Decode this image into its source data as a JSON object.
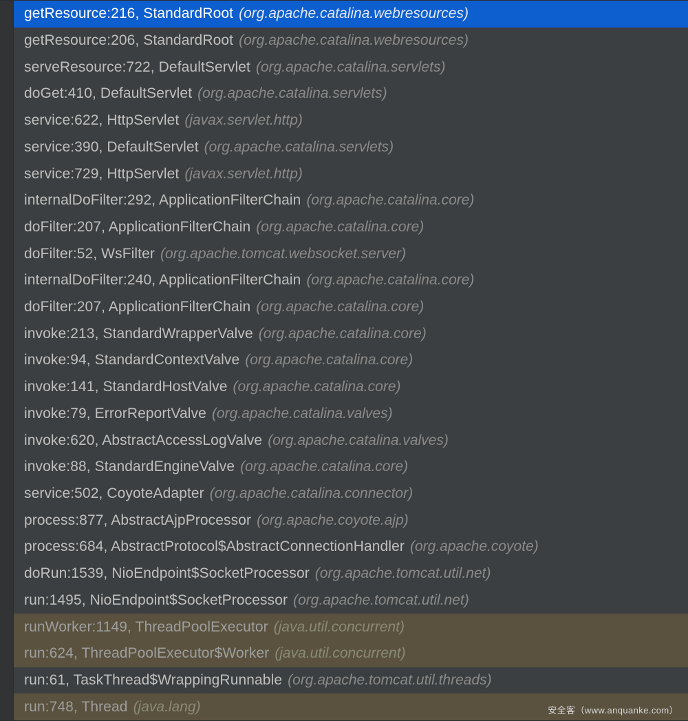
{
  "watermark": "安全客（www.anquanke.com）",
  "frames": [
    {
      "method": "getResource",
      "line": 216,
      "class": "StandardRoot",
      "package": "org.apache.catalina.webresources",
      "selected": true,
      "lib": false
    },
    {
      "method": "getResource",
      "line": 206,
      "class": "StandardRoot",
      "package": "org.apache.catalina.webresources",
      "selected": false,
      "lib": false
    },
    {
      "method": "serveResource",
      "line": 722,
      "class": "DefaultServlet",
      "package": "org.apache.catalina.servlets",
      "selected": false,
      "lib": false
    },
    {
      "method": "doGet",
      "line": 410,
      "class": "DefaultServlet",
      "package": "org.apache.catalina.servlets",
      "selected": false,
      "lib": false
    },
    {
      "method": "service",
      "line": 622,
      "class": "HttpServlet",
      "package": "javax.servlet.http",
      "selected": false,
      "lib": false
    },
    {
      "method": "service",
      "line": 390,
      "class": "DefaultServlet",
      "package": "org.apache.catalina.servlets",
      "selected": false,
      "lib": false
    },
    {
      "method": "service",
      "line": 729,
      "class": "HttpServlet",
      "package": "javax.servlet.http",
      "selected": false,
      "lib": false
    },
    {
      "method": "internalDoFilter",
      "line": 292,
      "class": "ApplicationFilterChain",
      "package": "org.apache.catalina.core",
      "selected": false,
      "lib": false
    },
    {
      "method": "doFilter",
      "line": 207,
      "class": "ApplicationFilterChain",
      "package": "org.apache.catalina.core",
      "selected": false,
      "lib": false
    },
    {
      "method": "doFilter",
      "line": 52,
      "class": "WsFilter",
      "package": "org.apache.tomcat.websocket.server",
      "selected": false,
      "lib": false
    },
    {
      "method": "internalDoFilter",
      "line": 240,
      "class": "ApplicationFilterChain",
      "package": "org.apache.catalina.core",
      "selected": false,
      "lib": false
    },
    {
      "method": "doFilter",
      "line": 207,
      "class": "ApplicationFilterChain",
      "package": "org.apache.catalina.core",
      "selected": false,
      "lib": false
    },
    {
      "method": "invoke",
      "line": 213,
      "class": "StandardWrapperValve",
      "package": "org.apache.catalina.core",
      "selected": false,
      "lib": false
    },
    {
      "method": "invoke",
      "line": 94,
      "class": "StandardContextValve",
      "package": "org.apache.catalina.core",
      "selected": false,
      "lib": false
    },
    {
      "method": "invoke",
      "line": 141,
      "class": "StandardHostValve",
      "package": "org.apache.catalina.core",
      "selected": false,
      "lib": false
    },
    {
      "method": "invoke",
      "line": 79,
      "class": "ErrorReportValve",
      "package": "org.apache.catalina.valves",
      "selected": false,
      "lib": false
    },
    {
      "method": "invoke",
      "line": 620,
      "class": "AbstractAccessLogValve",
      "package": "org.apache.catalina.valves",
      "selected": false,
      "lib": false
    },
    {
      "method": "invoke",
      "line": 88,
      "class": "StandardEngineValve",
      "package": "org.apache.catalina.core",
      "selected": false,
      "lib": false
    },
    {
      "method": "service",
      "line": 502,
      "class": "CoyoteAdapter",
      "package": "org.apache.catalina.connector",
      "selected": false,
      "lib": false
    },
    {
      "method": "process",
      "line": 877,
      "class": "AbstractAjpProcessor",
      "package": "org.apache.coyote.ajp",
      "selected": false,
      "lib": false
    },
    {
      "method": "process",
      "line": 684,
      "class": "AbstractProtocol$AbstractConnectionHandler",
      "package": "org.apache.coyote",
      "selected": false,
      "lib": false
    },
    {
      "method": "doRun",
      "line": 1539,
      "class": "NioEndpoint$SocketProcessor",
      "package": "org.apache.tomcat.util.net",
      "selected": false,
      "lib": false
    },
    {
      "method": "run",
      "line": 1495,
      "class": "NioEndpoint$SocketProcessor",
      "package": "org.apache.tomcat.util.net",
      "selected": false,
      "lib": false
    },
    {
      "method": "runWorker",
      "line": 1149,
      "class": "ThreadPoolExecutor",
      "package": "java.util.concurrent",
      "selected": false,
      "lib": true
    },
    {
      "method": "run",
      "line": 624,
      "class": "ThreadPoolExecutor$Worker",
      "package": "java.util.concurrent",
      "selected": false,
      "lib": true
    },
    {
      "method": "run",
      "line": 61,
      "class": "TaskThread$WrappingRunnable",
      "package": "org.apache.tomcat.util.threads",
      "selected": false,
      "lib": false
    },
    {
      "method": "run",
      "line": 748,
      "class": "Thread",
      "package": "java.lang",
      "selected": false,
      "lib": true
    }
  ]
}
